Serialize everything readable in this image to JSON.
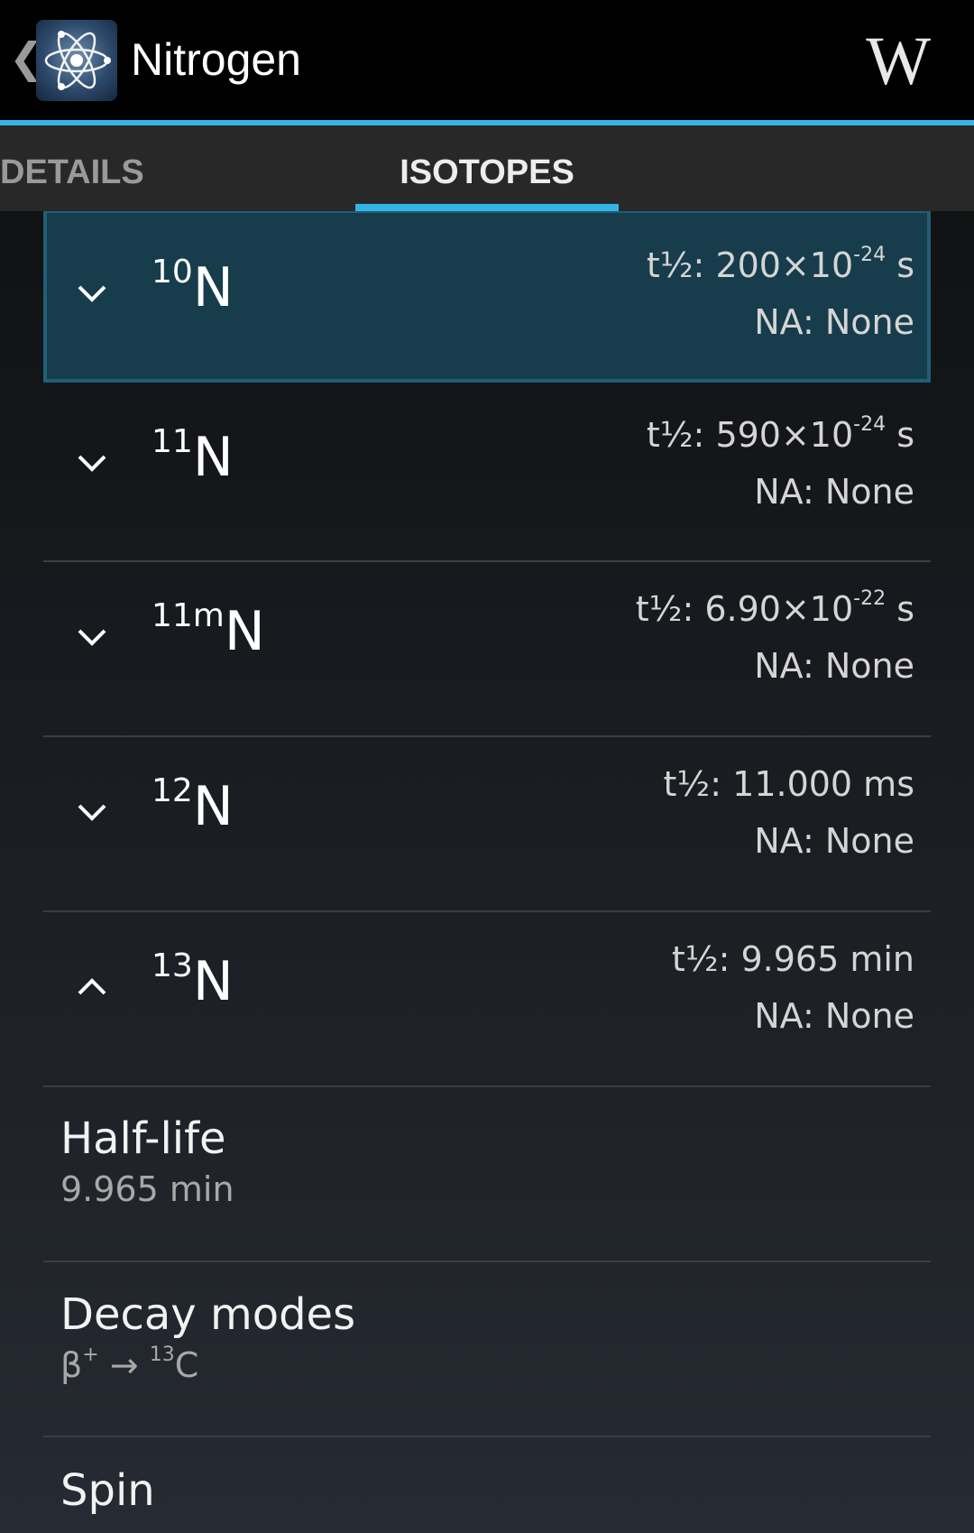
{
  "header": {
    "back_glyph": "❮",
    "title": "Nitrogen",
    "wiki_glyph": "W"
  },
  "tabs": [
    {
      "label": "DETAILS",
      "selected": false
    },
    {
      "label": "ISOTOPES",
      "selected": true
    }
  ],
  "isotopes": [
    {
      "mass": "10",
      "symbol": "N",
      "halflife_prefix": "t½: 200×10",
      "halflife_exp": "-24",
      "halflife_suffix": " s",
      "abundance": "NA: None",
      "expanded": false,
      "selected": true
    },
    {
      "mass": "11",
      "symbol": "N",
      "halflife_prefix": "t½: 590×10",
      "halflife_exp": "-24",
      "halflife_suffix": " s",
      "abundance": "NA: None",
      "expanded": false,
      "selected": false
    },
    {
      "mass": "11m",
      "symbol": "N",
      "halflife_prefix": "t½: 6.90×10",
      "halflife_exp": "-22",
      "halflife_suffix": " s",
      "abundance": "NA: None",
      "expanded": false,
      "selected": false
    },
    {
      "mass": "12",
      "symbol": "N",
      "halflife_prefix": "t½: 11.000 ms",
      "halflife_exp": "",
      "halflife_suffix": "",
      "abundance": "NA: None",
      "expanded": false,
      "selected": false
    },
    {
      "mass": "13",
      "symbol": "N",
      "halflife_prefix": "t½: 9.965 min",
      "halflife_exp": "",
      "halflife_suffix": "",
      "abundance": "NA: None",
      "expanded": true,
      "selected": false
    }
  ],
  "details": {
    "halflife": {
      "title": "Half-life",
      "value": "9.965 min"
    },
    "decay": {
      "title": "Decay modes",
      "value_prefix": "β",
      "value_sup": "+",
      "value_arrow": " → ",
      "value_mass": "13",
      "value_symbol": "C"
    },
    "spin": {
      "title": "Spin"
    }
  },
  "colors": {
    "accent": "#33b5e5",
    "selected_row": "#173d4c"
  },
  "icons": {
    "app": "atom-icon",
    "wiki": "wikipedia-icon",
    "collapsed": "chevron-down-icon",
    "expanded": "chevron-up-icon"
  }
}
